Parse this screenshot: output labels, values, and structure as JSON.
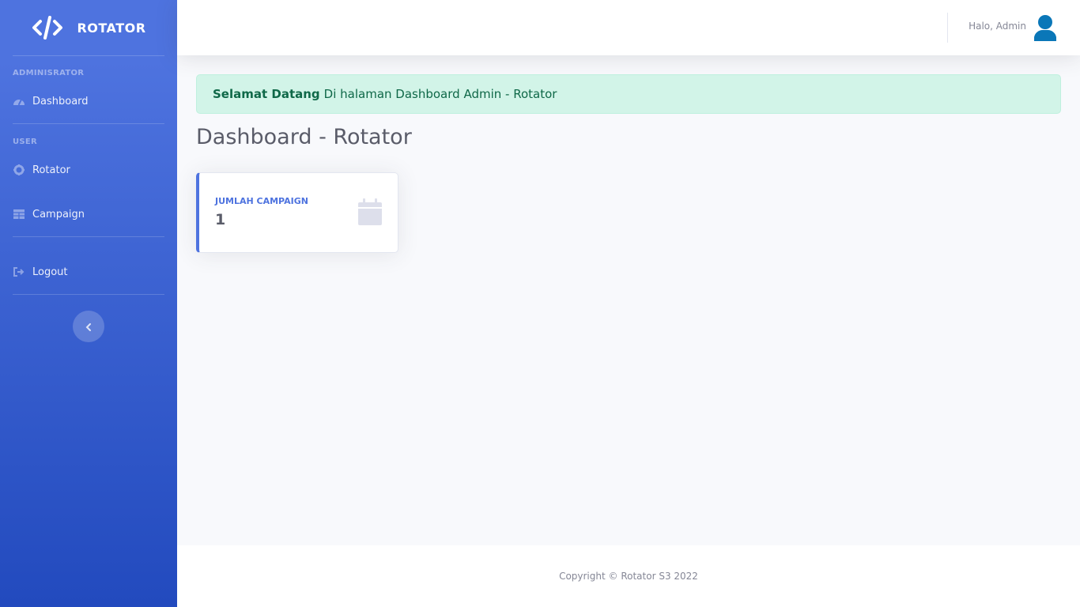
{
  "sidebar": {
    "brand": {
      "icon": "code-icon",
      "text": "ROTATOR"
    },
    "sections": [
      {
        "heading": "ADMINISRATOR",
        "items": [
          {
            "label": "Dashboard",
            "icon": "tachometer-icon"
          }
        ]
      },
      {
        "heading": "USER",
        "items": [
          {
            "label": "Rotator",
            "icon": "cog-icon"
          },
          {
            "label": "Campaign",
            "icon": "table-icon"
          }
        ]
      }
    ],
    "logout": {
      "label": "Logout",
      "icon": "sign-out-icon"
    },
    "toggle": {
      "icon": "chevron-left-icon"
    }
  },
  "topbar": {
    "user_greeting": "Halo, Admin",
    "avatar_icon": "user-icon",
    "avatar_color": "#0a77b8"
  },
  "main": {
    "alert": {
      "strong": "Selamat Datang",
      "text": "Di halaman Dashboard Admin - Rotator"
    },
    "page_title": "Dashboard - Rotator",
    "card": {
      "label": "JUMLAH CAMPAIGN",
      "value": "1",
      "icon": "calendar-icon",
      "accent": "#4e73df"
    }
  },
  "footer": {
    "text": "Copyright © Rotator S3 2022"
  },
  "colors": {
    "primary": "#4e73df",
    "primary_dark": "#224abe",
    "alert_bg": "#d2f4e8",
    "alert_text": "#0f6848"
  }
}
